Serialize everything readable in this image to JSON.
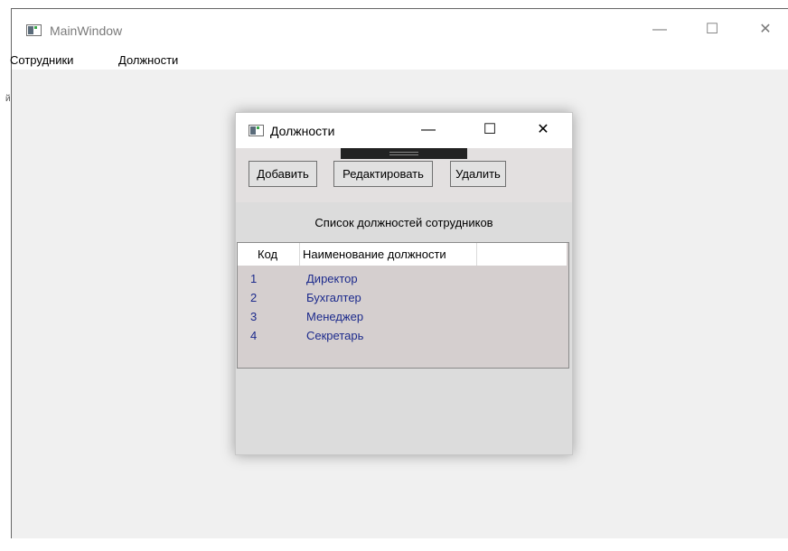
{
  "main_window": {
    "title": "MainWindow",
    "minimize": "—",
    "maximize": "☐",
    "close": "✕",
    "menu": [
      "Сотрудники",
      "Должности"
    ],
    "side_mark": "й"
  },
  "dialog": {
    "title": "Должности",
    "minimize": "—",
    "maximize": "☐",
    "close": "✕",
    "buttons": {
      "add": "Добавить",
      "edit": "Редактировать",
      "delete": "Удалить"
    },
    "caption": "Список должностей сотрудников",
    "grid": {
      "columns": [
        "Код",
        "Наименование должности"
      ],
      "rows": [
        {
          "code": "1",
          "name": "Директор"
        },
        {
          "code": "2",
          "name": "Бухгалтер"
        },
        {
          "code": "3",
          "name": "Менеджер"
        },
        {
          "code": "4",
          "name": "Секретарь"
        }
      ]
    }
  },
  "icons": {
    "app_icon": "window-app-icon"
  },
  "colors": {
    "row_text": "#1c2a8c",
    "grid_bg": "#d5cfcf",
    "dialog_bg": "#dcdcdc"
  }
}
